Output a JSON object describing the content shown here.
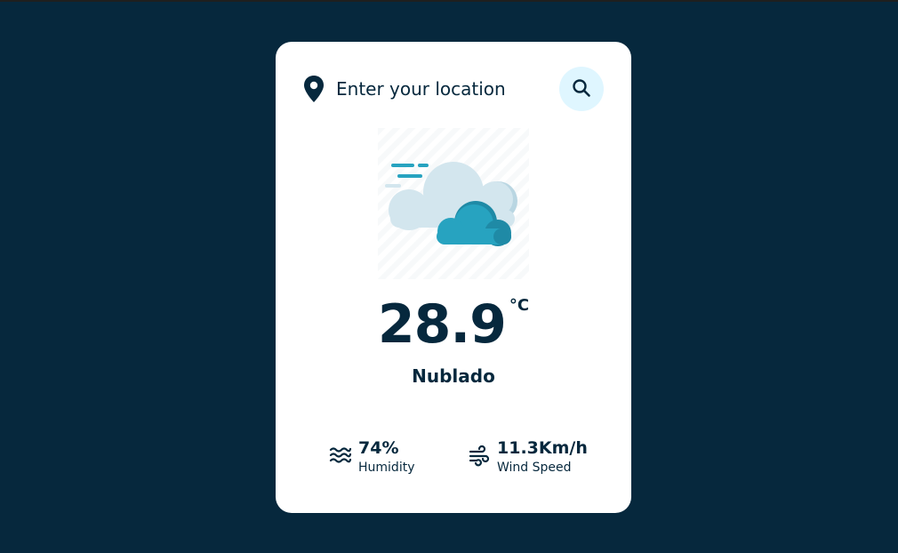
{
  "search": {
    "placeholder": "Enter your location",
    "value": ""
  },
  "weather": {
    "temperature": "28.9",
    "unit": "°C",
    "description": "Nublado",
    "humidity_value": "74%",
    "humidity_label": "Humidity",
    "wind_value": "11.3Km/h",
    "wind_label": "Wind Speed"
  },
  "colors": {
    "background": "#06283d",
    "card": "#ffffff",
    "search_button": "#dff6ff",
    "text": "#06283d",
    "cloud_front": "#27a3c0",
    "cloud_back": "#d3e6ee"
  },
  "icons": {
    "location": "location-pin-icon",
    "search": "search-icon",
    "weather": "cloud-icon",
    "humidity": "waves-icon",
    "wind": "wind-icon"
  }
}
